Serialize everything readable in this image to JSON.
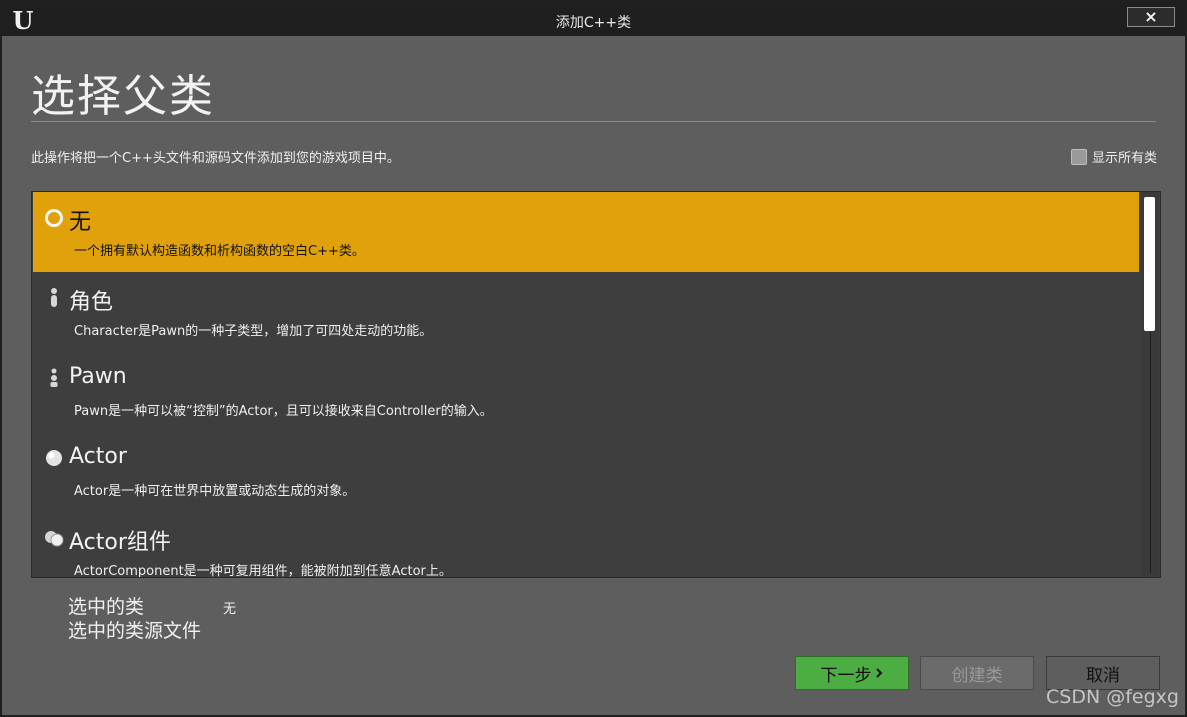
{
  "window": {
    "title": "添加C++类",
    "logo": "U",
    "close_icon": "×"
  },
  "header": {
    "title": "选择父类",
    "description": "此操作将把一个C++头文件和源码文件添加到您的游戏项目中。",
    "show_all_label": "显示所有类"
  },
  "classes": [
    {
      "name": "无",
      "description": "一个拥有默认构造函数和析构函数的空白C++类。",
      "icon": "ring-icon",
      "selected": true
    },
    {
      "name": "角色",
      "description": "Character是Pawn的一种子类型，增加了可四处走动的功能。",
      "icon": "character-icon",
      "selected": false
    },
    {
      "name": "Pawn",
      "description": "Pawn是一种可以被“控制”的Actor，且可以接收来自Controller的输入。",
      "icon": "pawn-icon",
      "selected": false
    },
    {
      "name": "Actor",
      "description": "Actor是一种可在世界中放置或动态生成的对象。",
      "icon": "sphere-icon",
      "selected": false
    },
    {
      "name": "Actor组件",
      "description": "ActorComponent是一种可复用组件，能被附加到任意Actor上。",
      "icon": "component-icon",
      "selected": false
    }
  ],
  "selection": {
    "selected_class_label": "选中的类",
    "selected_class_value": "无",
    "selected_source_label": "选中的类源文件"
  },
  "buttons": {
    "next": "下一步",
    "create": "创建类",
    "cancel": "取消"
  },
  "watermark": "CSDN @fegxg",
  "colors": {
    "selected_row": "#e0a10a",
    "next_button": "#4cad43",
    "panel": "#5e5e5e",
    "list_bg": "#3e3e3e"
  }
}
